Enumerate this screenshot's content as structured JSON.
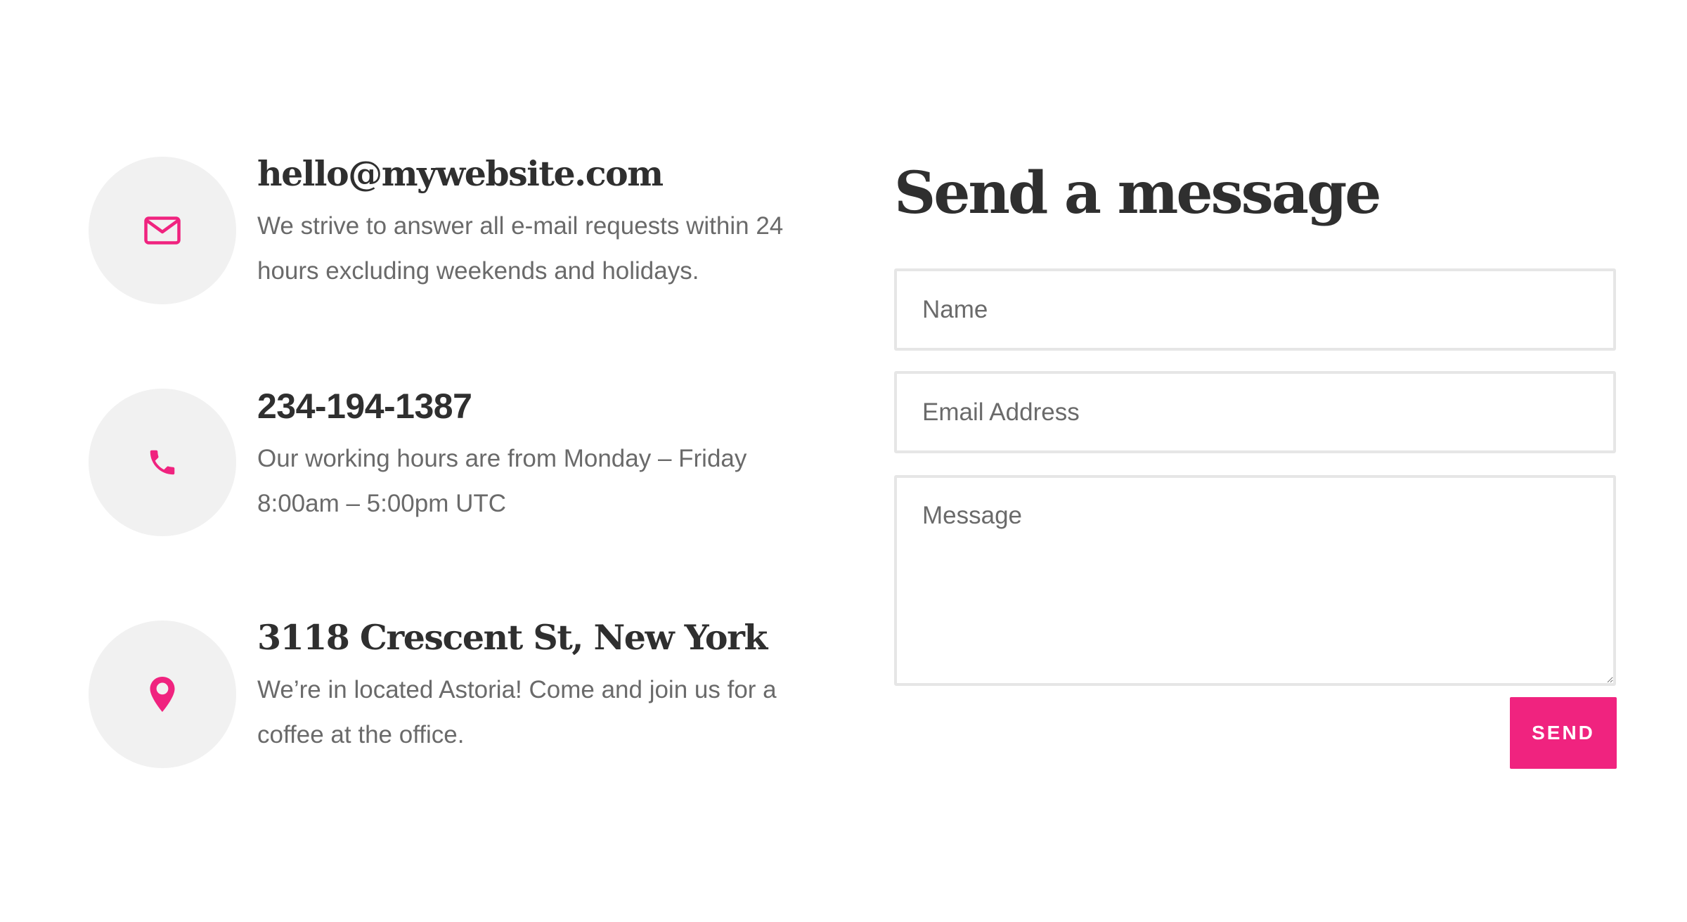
{
  "colors": {
    "accent": "#f0237f",
    "heading": "#2f2f2f",
    "body_text": "#6a6a6a",
    "icon_background": "#f1f1f1",
    "field_border": "#e6e6e6"
  },
  "contact": {
    "items": [
      {
        "icon": "mail-icon",
        "title": "hello@mywebsite.com",
        "description": "We strive to answer all e-mail requests within 24 hours excluding weekends and holidays."
      },
      {
        "icon": "phone-icon",
        "title": "234-194-1387",
        "description": "Our working hours are from Monday – Friday 8:00am – 5:00pm UTC"
      },
      {
        "icon": "location-pin-icon",
        "title": "3118 Crescent St, New York",
        "description": "We’re in located Astoria! Come and join us for a coffee at the office."
      }
    ]
  },
  "form": {
    "title": "Send a message",
    "name_placeholder": "Name",
    "email_placeholder": "Email Address",
    "message_placeholder": "Message",
    "submit_label": "SEND"
  }
}
